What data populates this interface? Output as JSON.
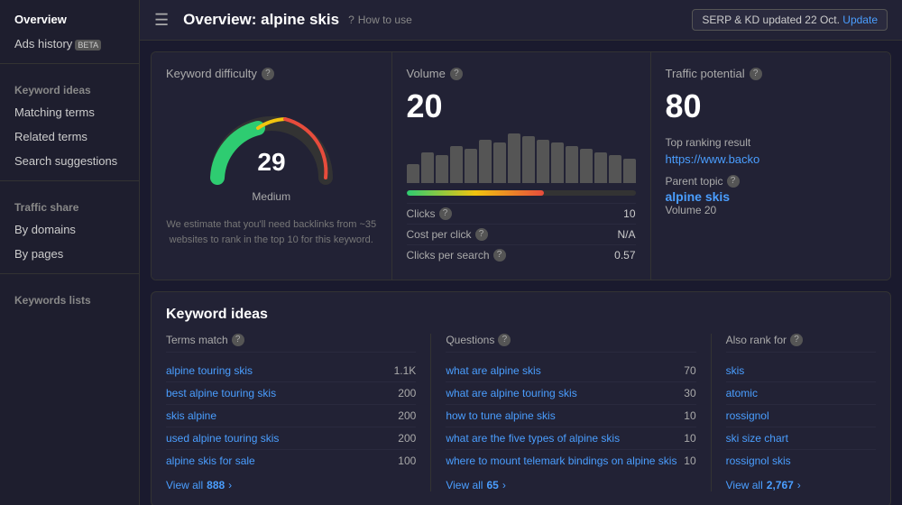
{
  "sidebar": {
    "menu_icon": "☰",
    "items": [
      {
        "id": "overview",
        "label": "Overview",
        "active": true,
        "badge": null
      },
      {
        "id": "ads-history",
        "label": "Ads history",
        "active": false,
        "badge": "BETA"
      }
    ],
    "keyword_ideas_group": "Keyword ideas",
    "keyword_ideas_items": [
      {
        "id": "matching-terms",
        "label": "Matching terms"
      },
      {
        "id": "related-terms",
        "label": "Related terms"
      },
      {
        "id": "search-suggestions",
        "label": "Search suggestions"
      }
    ],
    "traffic_share_group": "Traffic share",
    "traffic_share_items": [
      {
        "id": "by-domains",
        "label": "By domains"
      },
      {
        "id": "by-pages",
        "label": "By pages"
      }
    ],
    "keywords_lists_group": "Keywords lists"
  },
  "topbar": {
    "title": "Overview: alpine skis",
    "howto_label": "How to use",
    "serp_text": "SERP & KD updated 22 Oct.",
    "update_label": "Update"
  },
  "keyword_difficulty": {
    "title": "Keyword difficulty",
    "value": 29,
    "label": "Medium",
    "estimate": "We estimate that you'll need backlinks from ~35 websites to rank\nin the top 10 for this keyword."
  },
  "volume": {
    "title": "Volume",
    "value": 20,
    "bars": [
      30,
      50,
      45,
      60,
      55,
      70,
      65,
      80,
      75,
      70,
      65,
      60,
      55,
      50,
      45,
      40
    ],
    "clicks_label": "Clicks",
    "clicks_value": 10,
    "clicks_bar_pct": 60,
    "cost_per_click_label": "Cost per click",
    "cost_per_click_value": "N/A",
    "clicks_per_search_label": "Clicks per search",
    "clicks_per_search_value": "0.57"
  },
  "traffic_potential": {
    "title": "Traffic potential",
    "value": 80,
    "top_ranking_label": "Top ranking result",
    "top_ranking_url": "https://www.backo",
    "parent_topic_label": "Parent topic",
    "parent_topic_link": "alpine skis",
    "parent_volume_label": "Volume 20"
  },
  "keyword_ideas": {
    "section_title": "Keyword ideas",
    "terms_match": {
      "header": "Terms match",
      "rows": [
        {
          "term": "alpine touring skis",
          "value": "1.1K"
        },
        {
          "term": "best alpine touring skis",
          "value": "200"
        },
        {
          "term": "skis alpine",
          "value": "200"
        },
        {
          "term": "used alpine touring skis",
          "value": "200"
        },
        {
          "term": "alpine skis for sale",
          "value": "100"
        }
      ],
      "view_all_label": "View all",
      "view_all_count": "888",
      "chevron": "›"
    },
    "questions": {
      "header": "Questions",
      "rows": [
        {
          "term": "what are alpine skis",
          "value": 70
        },
        {
          "term": "what are alpine touring skis",
          "value": 30
        },
        {
          "term": "how to tune alpine skis",
          "value": 10
        },
        {
          "term": "what are the five types of alpine skis",
          "value": 10
        },
        {
          "term": "where to mount telemark bindings on alpine skis",
          "value": 10
        }
      ],
      "view_all_label": "View all",
      "view_all_count": "65",
      "chevron": "›"
    },
    "also_rank": {
      "header": "Also rank for",
      "rows": [
        {
          "term": "skis"
        },
        {
          "term": "atomic"
        },
        {
          "term": "rossignol"
        },
        {
          "term": "ski size chart"
        },
        {
          "term": "rossignol skis"
        }
      ],
      "view_all_label": "View all",
      "view_all_count": "2,767",
      "chevron": "›"
    }
  }
}
